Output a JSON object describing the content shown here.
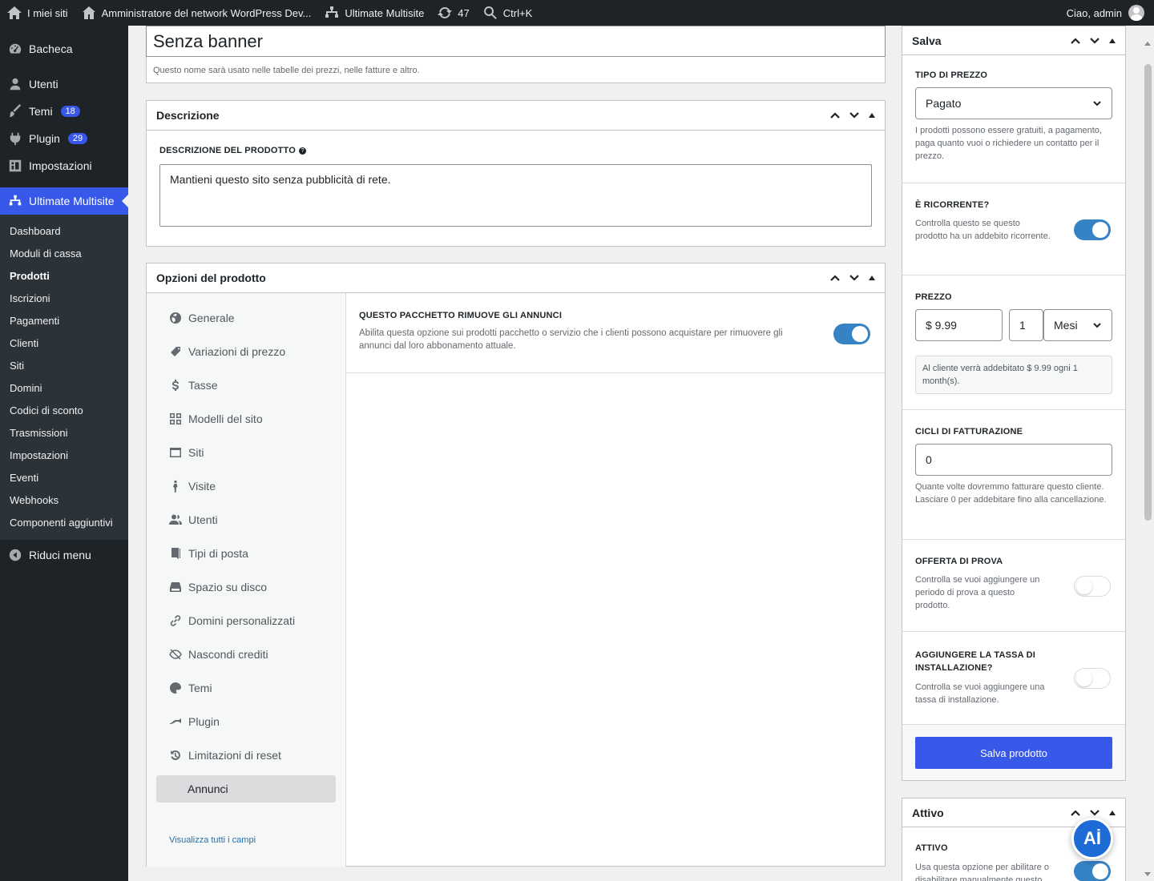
{
  "adminbar": {
    "my_sites": "I miei siti",
    "network_admin": "Amministratore del network WordPress Dev...",
    "ultimate": "Ultimate Multisite",
    "updates_count": "47",
    "search_shortcut": "Ctrl+K",
    "greeting": "Ciao, admin"
  },
  "sidebar": {
    "dashboard": "Bacheca",
    "users": "Utenti",
    "themes": "Temi",
    "themes_badge": "18",
    "plugins": "Plugin",
    "plugins_badge": "29",
    "settings": "Impostazioni",
    "ultimate": "Ultimate Multisite",
    "submenu": [
      "Dashboard",
      "Moduli di cassa",
      "Prodotti",
      "Iscrizioni",
      "Pagamenti",
      "Clienti",
      "Siti",
      "Domini",
      "Codici di sconto",
      "Trasmissioni",
      "Impostazioni",
      "Eventi",
      "Webhooks",
      "Componenti aggiuntivi"
    ],
    "collapse": "Riduci menu"
  },
  "main": {
    "product_name": "Senza banner",
    "product_name_help": "Questo nome sarà usato nelle tabelle dei prezzi, nelle fatture e altro.",
    "description_title": "Descrizione",
    "description_label": "Descrizione del prodotto",
    "description_value": "Mantieni questo sito senza pubblicità di rete.",
    "options_title": "Opzioni del prodotto",
    "tabs": [
      "Generale",
      "Variazioni di prezzo",
      "Tasse",
      "Modelli del sito",
      "Siti",
      "Visite",
      "Utenti",
      "Tipi di posta",
      "Spazio su disco",
      "Domini personalizzati",
      "Nascondi crediti",
      "Temi",
      "Plugin",
      "Limitazioni di reset",
      "Annunci"
    ],
    "view_all": "Visualizza tutti i campi",
    "ads_label": "Questo pacchetto rimuove gli annunci",
    "ads_help": "Abilita questa opzione sui prodotti pacchetto o servizio che i clienti possono acquistare per rimuovere gli annunci dal loro abbonamento attuale.",
    "ads_enabled": true
  },
  "save_box": {
    "title": "Salva",
    "price_type_label": "Tipo di prezzo",
    "price_type_value": "Pagato",
    "price_type_help": "I prodotti possono essere gratuiti, a pagamento, paga quanto vuoi o richiedere un contatto per il prezzo.",
    "recurring_label": "È ricorrente?",
    "recurring_help": "Controlla questo se questo prodotto ha un addebito ricorrente.",
    "recurring_enabled": true,
    "price_label": "Prezzo",
    "price_value": "$ 9.99",
    "interval_value": "1",
    "period_value": "Mesi",
    "price_summary": "Al cliente verrà addebitato $ 9.99 ogni 1 month(s).",
    "cycles_label": "Cicli di fatturazione",
    "cycles_value": "0",
    "cycles_help": "Quante volte dovremmo fatturare questo cliente. Lasciare 0 per addebitare fino alla cancellazione.",
    "trial_label": "Offerta di prova",
    "trial_help": "Controlla se vuoi aggiungere un periodo di prova a questo prodotto.",
    "trial_enabled": false,
    "setup_label": "Aggiungere la tassa di installazione?",
    "setup_help": "Controlla se vuoi aggiungere una tassa di installazione.",
    "setup_enabled": false,
    "save_button": "Salva prodotto"
  },
  "active_box": {
    "title": "Attivo",
    "label": "Attivo",
    "help": "Usa questa opzione per abilitare o disabilitare manualmente questo",
    "enabled": true
  },
  "fab_label": "Aİ",
  "colors": {
    "accent": "#3858e9",
    "toggle_on": "#3582c4",
    "adminbar": "#1d2327"
  }
}
